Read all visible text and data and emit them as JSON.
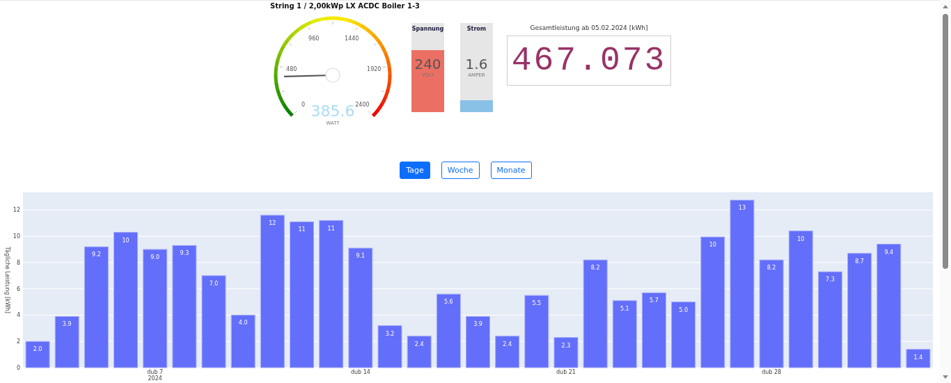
{
  "title": "String 1 / 2,00kWp LX ACDC Boiler 1-3",
  "gauge": {
    "ticks": [
      "0",
      "480",
      "960",
      "1440",
      "1920",
      "2400"
    ],
    "value": "385.6",
    "unit": "WATT",
    "level": 0.1607
  },
  "meters": [
    {
      "label": "Spannung",
      "value": "240",
      "unit": "VOLT",
      "level": 0.695,
      "color": "#ec6f64"
    },
    {
      "label": "Strom",
      "value": "1.6",
      "unit": "AMPER",
      "level": 0.13,
      "color": "#89c0e6"
    }
  ],
  "counter": {
    "label": "Gesamtleistung ab 05.02.2024 [kWh]",
    "value": "467.073"
  },
  "range_buttons": [
    {
      "label": "Tage",
      "selected": true
    },
    {
      "label": "Woche",
      "selected": false
    },
    {
      "label": "Monate",
      "selected": false
    }
  ],
  "chart": {
    "chart_data": {
      "type": "bar",
      "ylabel": "Tägliche Leistung [kWh]",
      "categories": [
        null,
        null,
        null,
        null,
        "dub 7\n2024",
        null,
        null,
        null,
        null,
        null,
        null,
        "dub 14",
        null,
        null,
        null,
        null,
        null,
        null,
        "dub 21",
        null,
        null,
        null,
        null,
        null,
        null,
        "dub 28",
        null,
        null,
        null,
        null,
        null
      ],
      "grid": true,
      "series": [
        {
          "color": "#636efa",
          "values": [
            2.0,
            3.9,
            9.2,
            10.3,
            9.0,
            9.3,
            7.0,
            4.0,
            11.6,
            11.1,
            11.2,
            9.1,
            3.2,
            2.4,
            5.6,
            3.9,
            2.4,
            5.5,
            2.3,
            8.2,
            5.1,
            5.7,
            5.0,
            9.95,
            12.75,
            8.2,
            10.4,
            7.3,
            8.7,
            9.4,
            1.4
          ]
        }
      ],
      "value_labels": [
        "2.0",
        "3.9",
        "9.2",
        "10",
        "9.0",
        "9.3",
        "7.0",
        "4.0",
        "12",
        "11",
        "11",
        "9.1",
        "3.2",
        "2.4",
        "5.6",
        "3.9",
        "2.4",
        "5.5",
        "2.3",
        "8.2",
        "5.1",
        "5.7",
        "5.0",
        "10",
        "13",
        "8.2",
        "10",
        "7.3",
        "8.7",
        "9.4",
        "1.4"
      ],
      "ylim": [
        0,
        13.35
      ],
      "yticks": [
        0,
        2,
        4,
        6,
        8,
        10,
        12
      ]
    }
  }
}
